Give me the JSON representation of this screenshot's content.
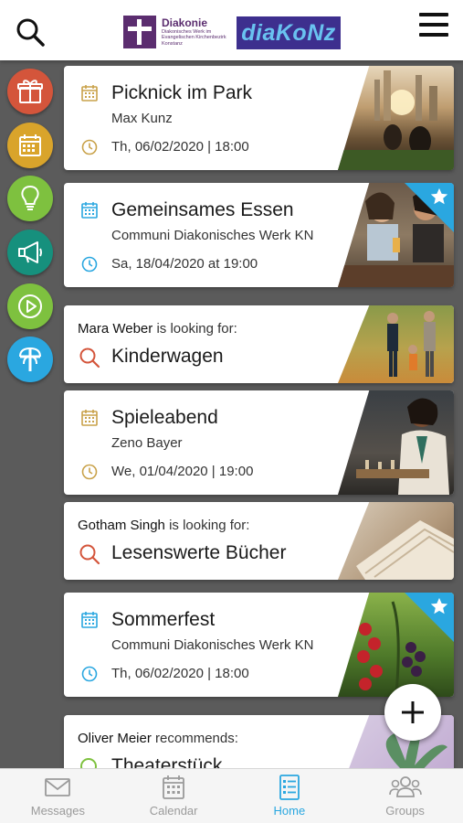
{
  "header": {
    "logo_diakonie_name": "Diakonie",
    "logo_diakonie_subtitle": "Diakonisches Werk im Evangelischen Kirchenbezirk Konstanz",
    "logo_diakonz": "diaKoNz",
    "icons": {
      "search": "search-icon",
      "menu": "hamburger-menu-icon"
    }
  },
  "sidebar": {
    "items": [
      {
        "name": "gift",
        "icon": "gift-icon",
        "color": "#d4553b"
      },
      {
        "name": "calendar",
        "icon": "calendar-icon",
        "color": "#d9a42b"
      },
      {
        "name": "ideas",
        "icon": "lightbulb-icon",
        "color": "#7ec13f"
      },
      {
        "name": "announcements",
        "icon": "megaphone-icon",
        "color": "#16907d"
      },
      {
        "name": "media",
        "icon": "play-icon",
        "color": "#7ec13f"
      },
      {
        "name": "diakonie",
        "icon": "diakonie-cross-icon",
        "color": "#2aa7e0"
      }
    ]
  },
  "feed": {
    "cards": [
      {
        "type": "event",
        "title": "Picknick im Park",
        "organizer": "Max Kunz",
        "date": "Th, 06/02/2020 | 18:00",
        "color": "#c9a24a",
        "starred": false
      },
      {
        "type": "event",
        "title": "Gemeinsames Essen",
        "organizer": "Communi Diakonisches Werk KN",
        "date": "Sa, 18/04/2020 at 19:00",
        "color": "#2aa7e0",
        "starred": true
      },
      {
        "type": "search",
        "person": "Mara Weber",
        "phrase": "is looking for:",
        "title": "Kinderwagen"
      },
      {
        "type": "event",
        "title": "Spieleabend",
        "organizer": "Zeno Bayer",
        "date": "We, 01/04/2020 | 19:00",
        "color": "#c9a24a",
        "starred": false
      },
      {
        "type": "search",
        "person": "Gotham Singh",
        "phrase": "is looking for:",
        "title": "Lesenswerte Bücher"
      },
      {
        "type": "event",
        "title": "Sommerfest",
        "organizer": "Communi Diakonisches Werk KN",
        "date": "Th, 06/02/2020 | 18:00",
        "color": "#2aa7e0",
        "starred": true
      },
      {
        "type": "recommendation",
        "person": "Oliver Meier",
        "phrase": "recommends:",
        "title": "Theaterstück"
      }
    ]
  },
  "fab": {
    "icon": "plus-icon"
  },
  "bottom_nav": {
    "items": [
      {
        "label": "Messages",
        "icon": "envelope-icon",
        "active": false
      },
      {
        "label": "Calendar",
        "icon": "calendar-icon",
        "active": false
      },
      {
        "label": "Home",
        "icon": "list-icon",
        "active": true
      },
      {
        "label": "Groups",
        "icon": "groups-icon",
        "active": false
      }
    ],
    "active_color": "#2aa7e0",
    "inactive_color": "#9a9a9a"
  }
}
